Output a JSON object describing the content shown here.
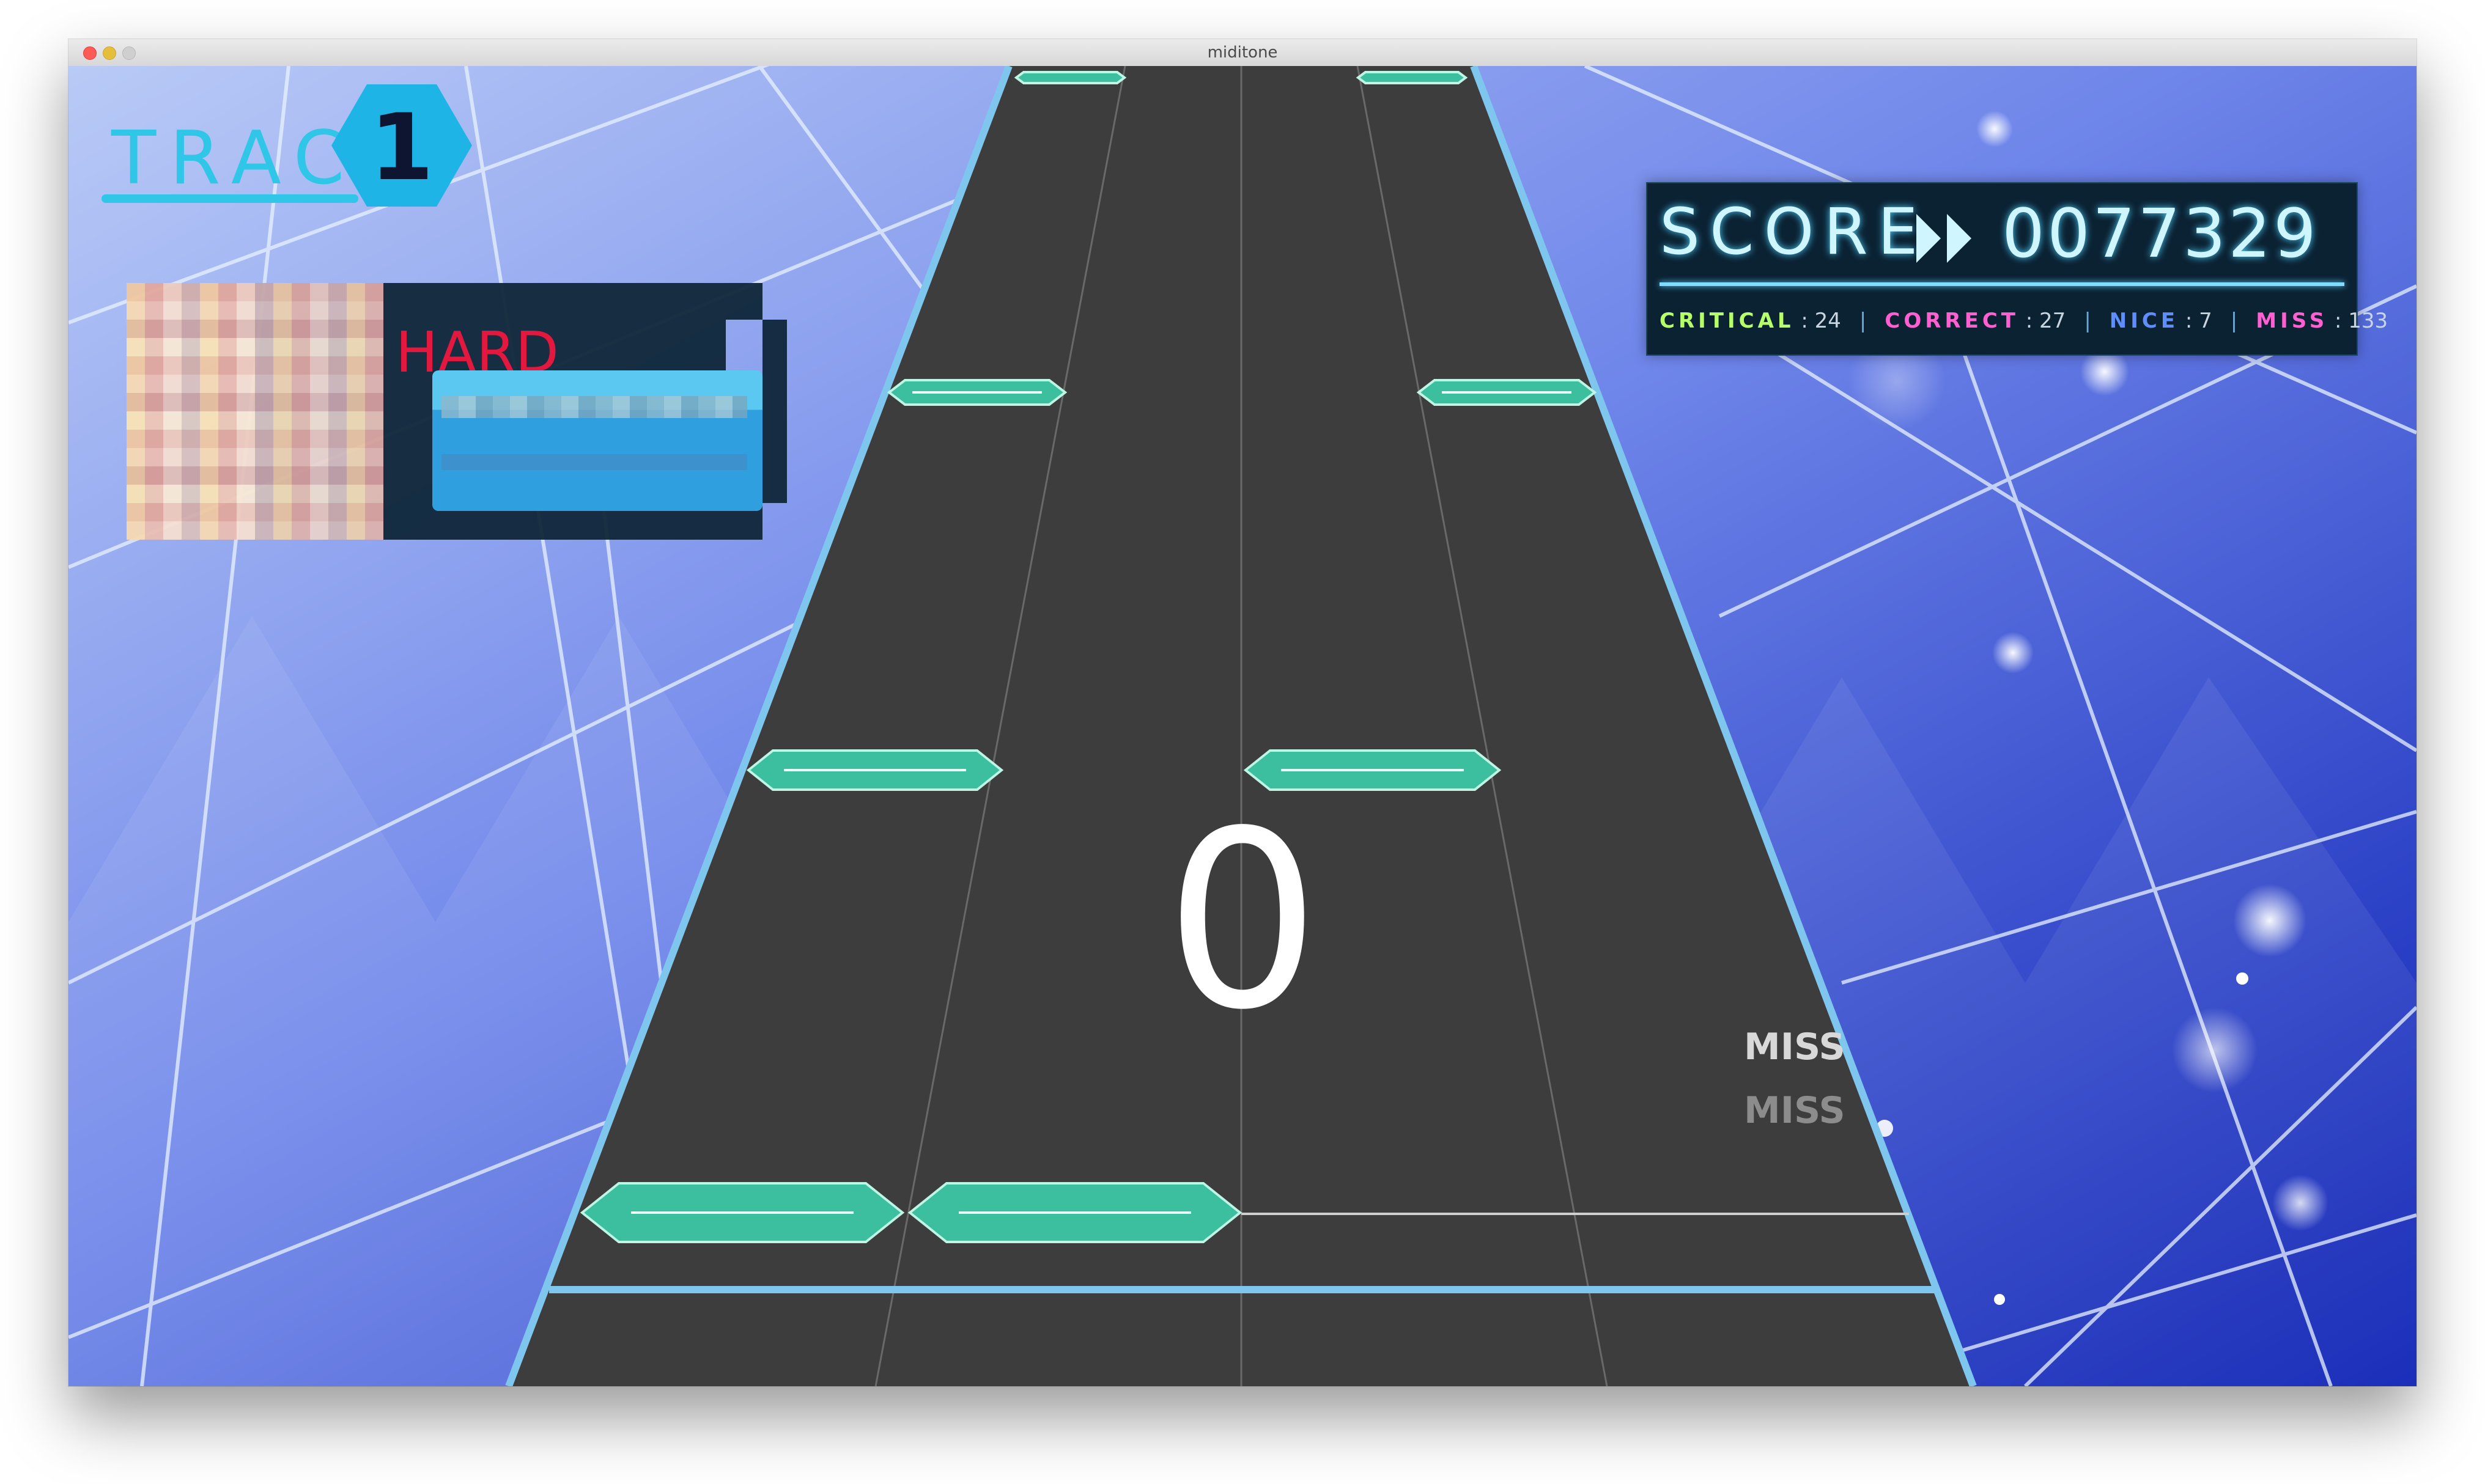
{
  "window": {
    "title": "miditone"
  },
  "track": {
    "label": "TRACK",
    "number": "1"
  },
  "song": {
    "difficulty": "HARD"
  },
  "score": {
    "label": "SCORE",
    "value": "0077329",
    "counts": [
      {
        "key": "CRITICAL",
        "value": "24",
        "color": "#b6ff6a"
      },
      {
        "key": "CORRECT",
        "value": "27",
        "color": "#ff5fd0"
      },
      {
        "key": "NICE",
        "value": "7",
        "color": "#5f8dff"
      },
      {
        "key": "MISS",
        "value": "133",
        "color": "#ff5fd0"
      }
    ]
  },
  "combo": "0",
  "judgements": [
    "MISS",
    "MISS"
  ],
  "colors": {
    "note": "#3cbf9f",
    "lane": "#3d3d3d",
    "edge": "#7fc6ee",
    "accent": "#2fc6e8"
  }
}
